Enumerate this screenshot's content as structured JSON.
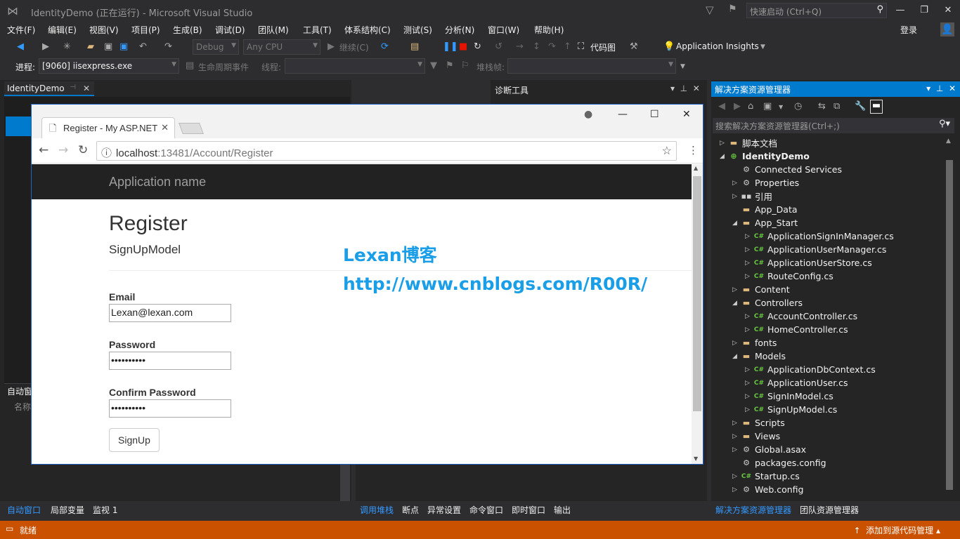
{
  "titlebar": {
    "title": "IdentityDemo (正在运行) - Microsoft Visual Studio",
    "quick_launch_placeholder": "快速启动 (Ctrl+Q)",
    "login": "登录"
  },
  "menu": [
    "文件(F)",
    "编辑(E)",
    "视图(V)",
    "项目(P)",
    "生成(B)",
    "调试(D)",
    "团队(M)",
    "工具(T)",
    "体系结构(C)",
    "测试(S)",
    "分析(N)",
    "窗口(W)",
    "帮助(H)"
  ],
  "toolbar": {
    "config": "Debug",
    "platform": "Any CPU",
    "continue": "继续(C)",
    "code_map": "代码图",
    "app_insights": "Application Insights"
  },
  "toolbar2": {
    "process_label": "进程:",
    "process_value": "[9060] iisexpress.exe",
    "lifecycle": "生命周期事件",
    "thread_label": "线程:",
    "stack_label": "堆栈帧:"
  },
  "doc_tab": {
    "label": "IdentityDemo"
  },
  "left_bottom": {
    "title": "自动窗",
    "name_col": "名称"
  },
  "left_bottom_tabs": [
    "自动窗口",
    "局部变量",
    "监视 1"
  ],
  "diag": {
    "title": "诊断工具"
  },
  "mid_bottom_tabs": [
    "调用堆栈",
    "断点",
    "异常设置",
    "命令窗口",
    "即时窗口",
    "输出"
  ],
  "solution_explorer": {
    "title": "解决方案资源管理器",
    "search_placeholder": "搜索解决方案资源管理器(Ctrl+;)",
    "tree": [
      {
        "label": "脚本文档",
        "indent": 0,
        "exp": "▷",
        "icon": "folder"
      },
      {
        "label": "IdentityDemo",
        "indent": 0,
        "exp": "◢",
        "icon": "proj",
        "bold": true
      },
      {
        "label": "Connected Services",
        "indent": 1,
        "exp": "",
        "icon": "gear"
      },
      {
        "label": "Properties",
        "indent": 1,
        "exp": "▷",
        "icon": "gear"
      },
      {
        "label": "引用",
        "indent": 1,
        "exp": "▷",
        "icon": "ref"
      },
      {
        "label": "App_Data",
        "indent": 1,
        "exp": "",
        "icon": "folder"
      },
      {
        "label": "App_Start",
        "indent": 1,
        "exp": "◢",
        "icon": "folder"
      },
      {
        "label": "ApplicationSignInManager.cs",
        "indent": 2,
        "exp": "▷",
        "icon": "cs"
      },
      {
        "label": "ApplicationUserManager.cs",
        "indent": 2,
        "exp": "▷",
        "icon": "cs"
      },
      {
        "label": "ApplicationUserStore.cs",
        "indent": 2,
        "exp": "▷",
        "icon": "cs"
      },
      {
        "label": "RouteConfig.cs",
        "indent": 2,
        "exp": "▷",
        "icon": "cs"
      },
      {
        "label": "Content",
        "indent": 1,
        "exp": "▷",
        "icon": "folder"
      },
      {
        "label": "Controllers",
        "indent": 1,
        "exp": "◢",
        "icon": "folder"
      },
      {
        "label": "AccountController.cs",
        "indent": 2,
        "exp": "▷",
        "icon": "cs"
      },
      {
        "label": "HomeController.cs",
        "indent": 2,
        "exp": "▷",
        "icon": "cs"
      },
      {
        "label": "fonts",
        "indent": 1,
        "exp": "▷",
        "icon": "folder"
      },
      {
        "label": "Models",
        "indent": 1,
        "exp": "◢",
        "icon": "folder"
      },
      {
        "label": "ApplicationDbContext.cs",
        "indent": 2,
        "exp": "▷",
        "icon": "cs"
      },
      {
        "label": "ApplicationUser.cs",
        "indent": 2,
        "exp": "▷",
        "icon": "cs"
      },
      {
        "label": "SignInModel.cs",
        "indent": 2,
        "exp": "▷",
        "icon": "cs"
      },
      {
        "label": "SignUpModel.cs",
        "indent": 2,
        "exp": "▷",
        "icon": "cs"
      },
      {
        "label": "Scripts",
        "indent": 1,
        "exp": "▷",
        "icon": "folder"
      },
      {
        "label": "Views",
        "indent": 1,
        "exp": "▷",
        "icon": "folder"
      },
      {
        "label": "Global.asax",
        "indent": 1,
        "exp": "▷",
        "icon": "gear"
      },
      {
        "label": "packages.config",
        "indent": 1,
        "exp": "",
        "icon": "gear"
      },
      {
        "label": "Startup.cs",
        "indent": 1,
        "exp": "▷",
        "icon": "cs"
      },
      {
        "label": "Web.config",
        "indent": 1,
        "exp": "▷",
        "icon": "gear"
      }
    ]
  },
  "se_bottom_tabs": [
    "解决方案资源管理器",
    "团队资源管理器"
  ],
  "statusbar": {
    "text": "就绪",
    "right": "添加到源代码管理"
  },
  "browser": {
    "tab_title": "Register - My ASP.NET",
    "url_host": "localhost",
    "url_rest": ":13481/Account/Register",
    "page": {
      "app_name": "Application name",
      "heading": "Register",
      "subheading": "SignUpModel",
      "email_label": "Email",
      "email_value": "Lexan@lexan.com",
      "password_label": "Password",
      "password_value": "••••••••••",
      "confirm_label": "Confirm Password",
      "confirm_value": "••••••••••",
      "submit": "SignUp"
    }
  },
  "watermark": {
    "line1": "Lexan博客",
    "line2": "http://www.cnblogs.com/R00R/"
  },
  "colors": {
    "accent": "#007acc",
    "status": "#ca5100",
    "watermark": "#1a9ee8"
  }
}
